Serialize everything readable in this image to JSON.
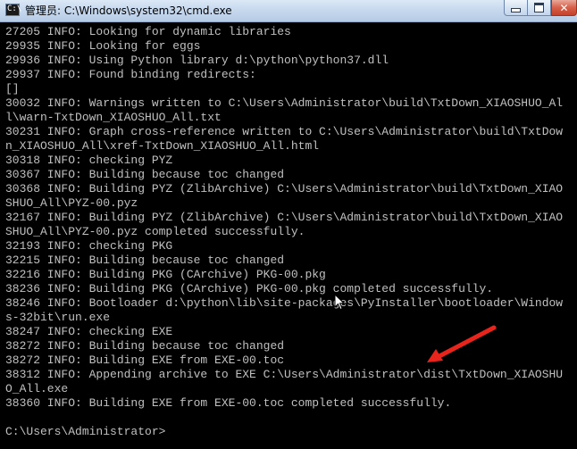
{
  "window": {
    "title": "管理员: C:\\Windows\\system32\\cmd.exe",
    "icon": "cmd-icon",
    "controls": {
      "minimize_icon": "minimize-icon",
      "maximize_icon": "maximize-icon",
      "close_icon": "close-icon",
      "close_glyph": "✕"
    }
  },
  "console": {
    "background": "#000000",
    "foreground": "#c0c0c0",
    "lines": [
      "27205 INFO: Looking for dynamic libraries",
      "29935 INFO: Looking for eggs",
      "29936 INFO: Using Python library d:\\python\\python37.dll",
      "29937 INFO: Found binding redirects:",
      "[]",
      "30032 INFO: Warnings written to C:\\Users\\Administrator\\build\\TxtDown_XIAOSHUO_Al",
      "l\\warn-TxtDown_XIAOSHUO_All.txt",
      "30231 INFO: Graph cross-reference written to C:\\Users\\Administrator\\build\\TxtDow",
      "n_XIAOSHUO_All\\xref-TxtDown_XIAOSHUO_All.html",
      "30318 INFO: checking PYZ",
      "30367 INFO: Building because toc changed",
      "30368 INFO: Building PYZ (ZlibArchive) C:\\Users\\Administrator\\build\\TxtDown_XIAO",
      "SHUO_All\\PYZ-00.pyz",
      "32167 INFO: Building PYZ (ZlibArchive) C:\\Users\\Administrator\\build\\TxtDown_XIAO",
      "SHUO_All\\PYZ-00.pyz completed successfully.",
      "32193 INFO: checking PKG",
      "32215 INFO: Building because toc changed",
      "32216 INFO: Building PKG (CArchive) PKG-00.pkg",
      "38236 INFO: Building PKG (CArchive) PKG-00.pkg completed successfully.",
      "38246 INFO: Bootloader d:\\python\\lib\\site-packages\\PyInstaller\\bootloader\\Window",
      "s-32bit\\run.exe",
      "38247 INFO: checking EXE",
      "38272 INFO: Building because toc changed",
      "38272 INFO: Building EXE from EXE-00.toc",
      "38312 INFO: Appending archive to EXE C:\\Users\\Administrator\\dist\\TxtDown_XIAOSHU",
      "O_All.exe",
      "38360 INFO: Building EXE from EXE-00.toc completed successfully.",
      "",
      "C:\\Users\\Administrator>"
    ]
  },
  "annotation": {
    "icon": "red-arrow-icon",
    "color": "#e8251c"
  },
  "pointer": {
    "icon": "mouse-cursor-icon"
  }
}
